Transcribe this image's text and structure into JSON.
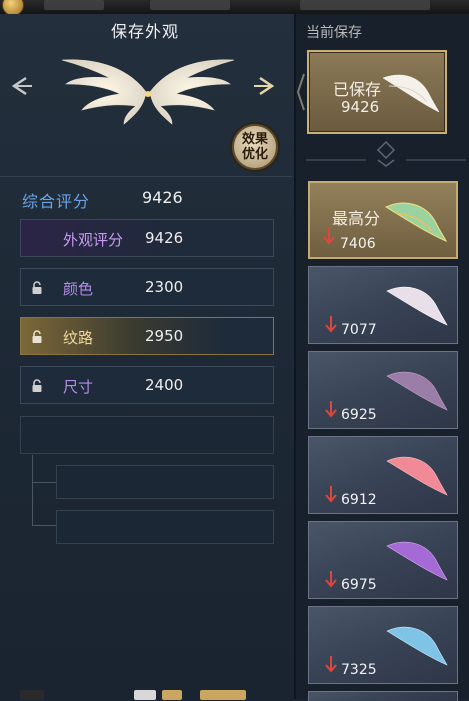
{
  "left_panel": {
    "title": "保存外观",
    "effect_button": {
      "line1": "效果",
      "line2": "优化"
    },
    "total_score": {
      "label": "综合评分",
      "value": "9426"
    },
    "rows": [
      {
        "label": "外观评分",
        "value": "9426",
        "locked": false
      },
      {
        "label": "颜色",
        "value": "2300",
        "locked": true
      },
      {
        "label": "纹路",
        "value": "2950",
        "locked": true
      },
      {
        "label": "尺寸",
        "value": "2400",
        "locked": true
      }
    ]
  },
  "right_panel": {
    "label": "当前保存",
    "saved": {
      "label": "已保存",
      "value": "9426"
    },
    "best": {
      "label": "最高分",
      "value": "7406"
    },
    "candidates": [
      {
        "value": "7077",
        "wing_color": "#e8dfe8"
      },
      {
        "value": "6925",
        "wing_color": "#9b7ea8"
      },
      {
        "value": "6912",
        "wing_color": "#f08a96"
      },
      {
        "value": "6975",
        "wing_color": "#a66ad6"
      },
      {
        "value": "7325",
        "wing_color": "#7fc4e6"
      }
    ]
  },
  "colors": {
    "accent_blue": "#6aa4e6",
    "gold_border": "#c9b078",
    "down_arrow": "#e0463c",
    "purple_label": "#b58de6"
  }
}
